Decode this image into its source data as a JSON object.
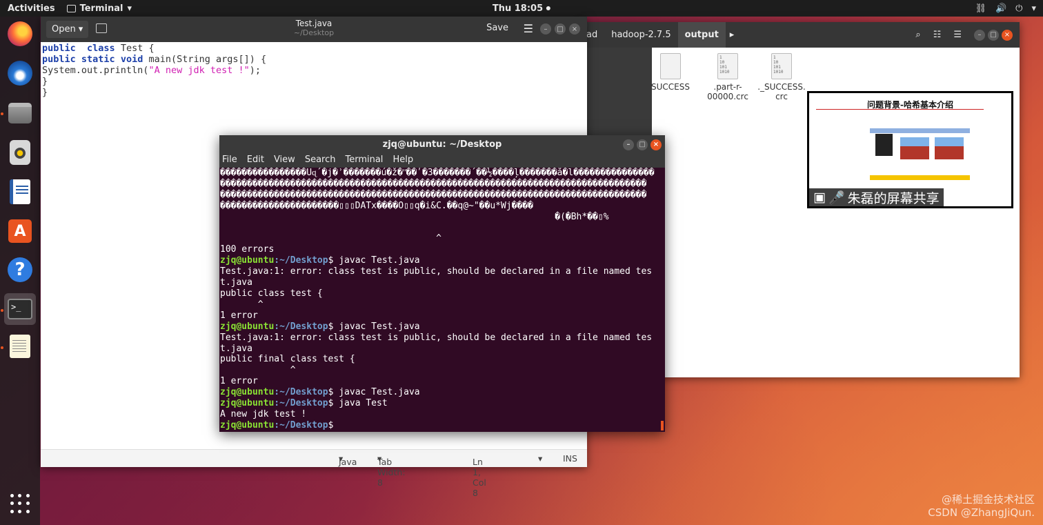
{
  "topbar": {
    "activities": "Activities",
    "app_name": "Terminal",
    "clock": "Thu 18:05"
  },
  "dock": {
    "items": [
      "firefox",
      "thunderbird",
      "files",
      "rhythmbox",
      "libreoffice-writer",
      "ubuntu-software",
      "help",
      "terminal",
      "text-editor"
    ],
    "active": "terminal"
  },
  "files_window": {
    "breadcrumb_partial": "ad",
    "breadcrumbs": [
      "hadoop-2.7.5",
      "output"
    ],
    "files": [
      {
        "name": "_SUCCESS",
        "label": "SUCCESS"
      },
      {
        "name": ".part-r-00000.crc",
        "label1": ".part-r-",
        "label2": "00000.crc"
      },
      {
        "name": "._SUCCESS.crc",
        "label1": "._SUCCESS.",
        "label2": "crc"
      }
    ],
    "preview": {
      "title": "问题背景-哈希基本介绍",
      "caption": "朱磊的屏幕共享"
    }
  },
  "gedit": {
    "open_label": "Open",
    "title": "Test.java",
    "subtitle": "~/Desktop",
    "save_label": "Save",
    "status": {
      "language": "Java",
      "tab_width": "Tab Width: 8",
      "position": "Ln 1, Col 8",
      "mode": "INS"
    }
  },
  "terminal": {
    "title": "zjq@ubuntu: ~/Desktop",
    "menu": [
      "File",
      "Edit",
      "View",
      "Search",
      "Terminal",
      "Help"
    ],
    "prompt_user": "zjq@ubuntu",
    "prompt_path": ":~/Desktop",
    "prompt_end": "$ ",
    "lines": {
      "garbage1": "����������������Uɋ´�j�ʾ�������ú�ž�ʺ��ʹ�3�������́ ��½����ļ�������å�l���������������",
      "garbage2": "�������������������������������������������������������������������������������",
      "garbage3": "�������������������������������������������������������������������������������",
      "garbage4": "����������������������▯▯▯DATx����O▯▯q�i&C.��q@~\"��u*Wj����",
      "garbage5": "                                                              �(�Bh*��▯%",
      "caret1": "                                        ^",
      "errors100": "100 errors",
      "cmd1": "javac Test.java",
      "err_a": "Test.java:1: error: class test is public, should be declared in a file named tes",
      "err_b": "t.java",
      "src1": "public class test {",
      "caret2": "       ^",
      "one_error": "1 error",
      "cmd2": "javac Test.java",
      "src2": "public final class test {",
      "caret3": "             ^",
      "cmd3": "javac Test.java",
      "cmd4": "java Test",
      "output": "A new jdk test !"
    }
  },
  "watermark": {
    "line1": "@稀土掘金技术社区",
    "line2": "CSDN @ZhangJiQun."
  }
}
